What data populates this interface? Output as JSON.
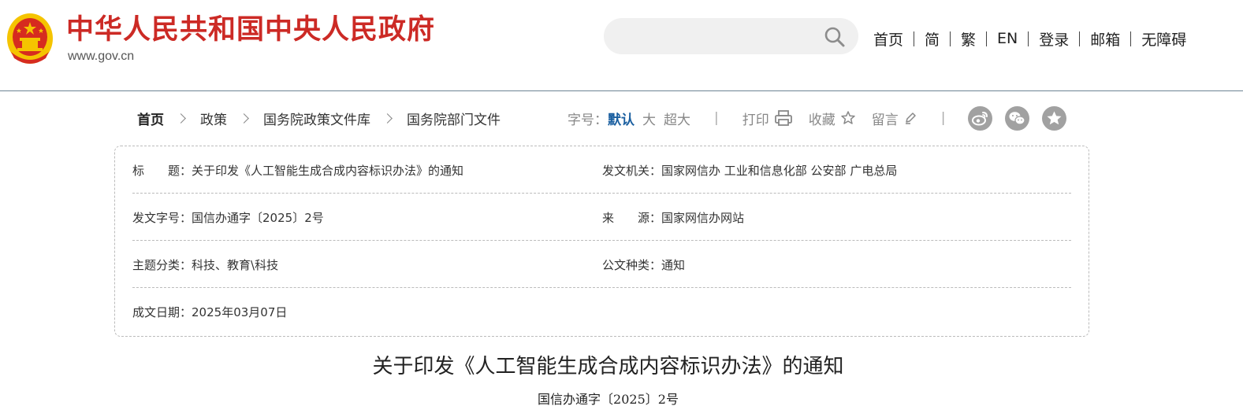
{
  "header": {
    "site_title": "中华人民共和国中央人民政府",
    "site_url": "www.gov.cn",
    "search": {
      "value": "",
      "placeholder": ""
    },
    "nav": [
      "首页",
      "简",
      "繁",
      "EN",
      "登录",
      "邮箱",
      "无障碍"
    ]
  },
  "breadcrumb": {
    "home": "首页",
    "items": [
      "政策",
      "国务院政策文件库",
      "国务院部门文件"
    ]
  },
  "toolbar": {
    "font_size_label": "字号：",
    "font_default": "默认",
    "font_large": "大",
    "font_xlarge": "超大",
    "separator": "|",
    "print": "打印",
    "favorite": "收藏",
    "comment": "留言"
  },
  "social": [
    "weibo-icon",
    "wechat-icon",
    "star-icon"
  ],
  "info": {
    "title_label": "标　　题：",
    "title_value": "关于印发《人工智能生成合成内容标识办法》的通知",
    "issuer_label": "发文机关：",
    "issuer_value": "国家网信办 工业和信息化部 公安部 广电总局",
    "docno_label": "发文字号：",
    "docno_value": "国信办通字〔2025〕2号",
    "source_label": "来　　源：",
    "source_value": "国家网信办网站",
    "topic_label": "主题分类：",
    "topic_value": "科技、教育\\科技",
    "doctype_label": "公文种类：",
    "doctype_value": "通知",
    "date_label": "成文日期：",
    "date_value": "2025年03月07日"
  },
  "article": {
    "title": "关于印发《人工智能生成合成内容标识办法》的通知",
    "doc_number": "国信办通字〔2025〕2号"
  },
  "colors": {
    "brand_red": "#cc2a25",
    "emblem_gold": "#f5c400",
    "link_blue": "#1a5fa0",
    "icon_gray": "#a1a1a1"
  }
}
